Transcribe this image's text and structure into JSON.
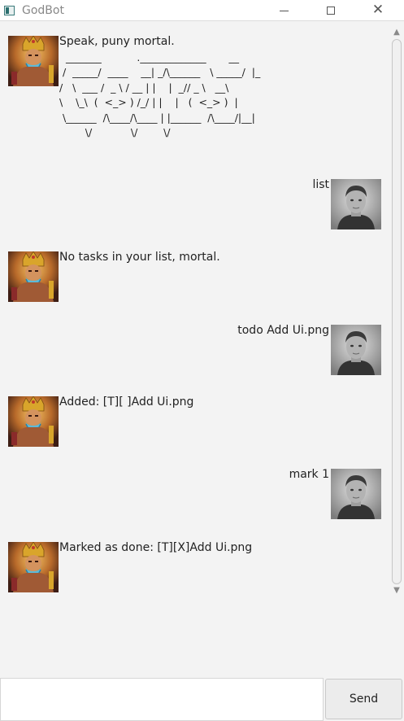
{
  "window": {
    "title": "GodBot",
    "controls": [
      "minimize",
      "maximize",
      "close"
    ]
  },
  "messages": [
    {
      "sender": "bot",
      "text": "Speak, puny mortal.",
      "ascii_art": "  _______           ._____________       __\n /  _____/  ____    __| _/\\______   \\ _____/  |_\n/   \\  ___ /  _ \\ / __ | |    |  _// _ \\   __\\\n\\    \\_\\  (  <_> ) /_/ | |    |   (  <_> )  |\n \\______  /\\____/\\____ | |______  /\\____/|__|\n        \\/            \\/        \\/"
    },
    {
      "sender": "user",
      "text": "list"
    },
    {
      "sender": "bot",
      "text": "No tasks in your list, mortal."
    },
    {
      "sender": "user",
      "text": "todo Add Ui.png"
    },
    {
      "sender": "bot",
      "text": "Added: [T][ ]Add Ui.png"
    },
    {
      "sender": "user",
      "text": "mark 1"
    },
    {
      "sender": "bot",
      "text": "Marked as done: [T][X]Add Ui.png"
    }
  ],
  "input": {
    "value": "",
    "placeholder": ""
  },
  "send_button": {
    "label": "Send"
  },
  "colors": {
    "background": "#f3f3f3",
    "titlebar": "#ffffff",
    "text": "#222222"
  },
  "icons": {
    "bot_avatar": "god-avatar",
    "user_avatar": "user-avatar",
    "app": "app-icon"
  }
}
